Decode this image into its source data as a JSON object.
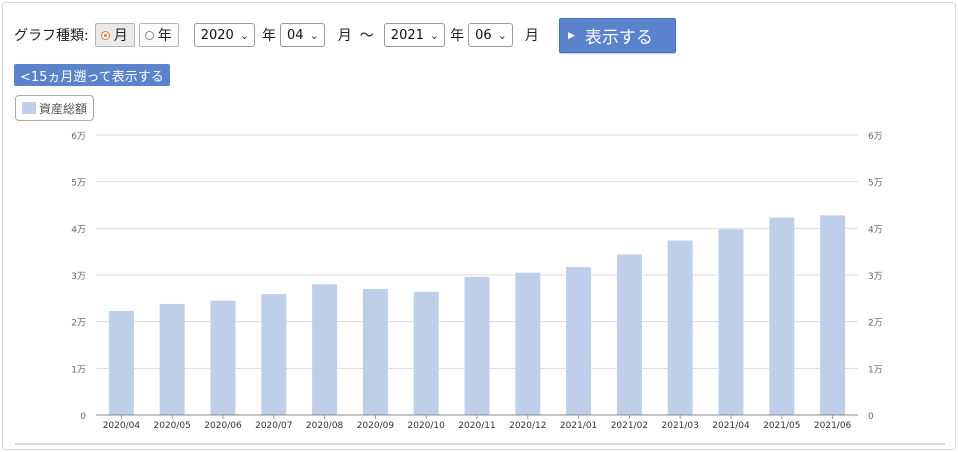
{
  "controls": {
    "graph_type_label": "グラフ種類:",
    "radio_month": "月",
    "radio_year": "年",
    "from_year": "2020",
    "from_year_unit": "年",
    "from_month": "04",
    "from_month_unit": "月",
    "range_sep": "〜",
    "to_year": "2021",
    "to_year_unit": "年",
    "to_month": "06",
    "to_month_unit": "月",
    "show_button": "表示する",
    "back_button": "<15ヵ月遡って表示する"
  },
  "legend": {
    "label": "資産総額",
    "color": "#bfcfea"
  },
  "chart_data": {
    "type": "bar",
    "title": "",
    "xlabel": "",
    "ylabel": "",
    "categories": [
      "2020/04",
      "2020/05",
      "2020/06",
      "2020/07",
      "2020/08",
      "2020/09",
      "2020/10",
      "2020/11",
      "2020/12",
      "2021/01",
      "2021/02",
      "2021/03",
      "2021/04",
      "2021/05",
      "2021/06"
    ],
    "series": [
      {
        "name": "資産総額",
        "values": [
          22300,
          23800,
          24500,
          25900,
          28000,
          27000,
          26400,
          29600,
          30500,
          31700,
          34400,
          37400,
          39800,
          42300,
          42800
        ]
      }
    ],
    "ylim": [
      0,
      60000
    ],
    "yticks": [
      0,
      10000,
      20000,
      30000,
      40000,
      50000,
      60000
    ],
    "ytick_labels": [
      "0",
      "1万",
      "2万",
      "3万",
      "4万",
      "5万",
      "6万"
    ],
    "grid": true,
    "right_axis_labels": true,
    "bar_color": "#bfcfea"
  }
}
